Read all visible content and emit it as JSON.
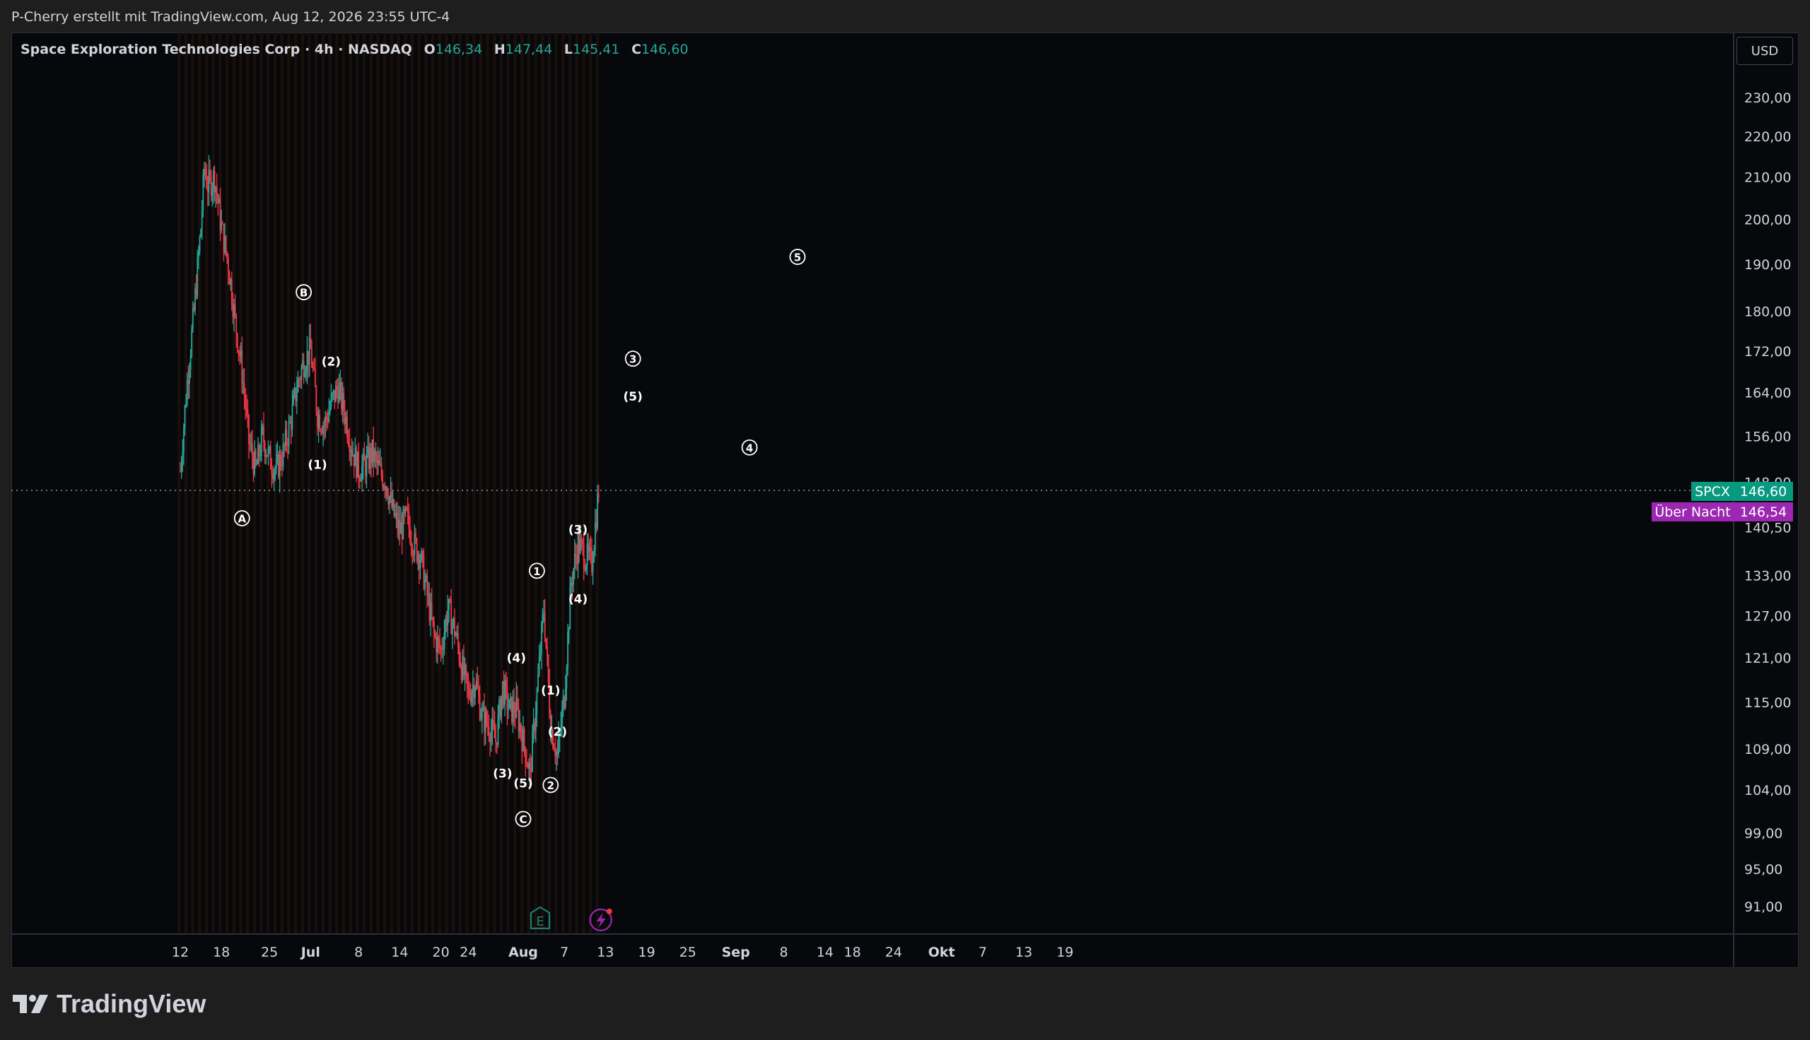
{
  "header": {
    "attribution": "P-Cherry erstellt mit TradingView.com, Aug 12, 2026 23:55 UTC-4"
  },
  "legend": {
    "title": "Space Exploration Technologies Corp · 4h · NASDAQ",
    "open_label": "O",
    "open": "146,34",
    "high_label": "H",
    "high": "147,44",
    "low_label": "L",
    "low": "145,41",
    "close_label": "C",
    "close": "146,60"
  },
  "currency_button": "USD",
  "brand": {
    "name": "TradingView",
    "icon": "tradingview-logo-icon"
  },
  "price_badges": [
    {
      "symbol": "SPCX",
      "value": "146,60",
      "color": "#089981"
    },
    {
      "symbol": "Über Nacht",
      "value": "146,54",
      "color": "#9c27b0"
    }
  ],
  "markers": [
    {
      "icon": "earnings-e-icon",
      "color": "#1e7f6e"
    },
    {
      "icon": "lightning-event-icon",
      "color": "#9c27b0"
    }
  ],
  "colors": {
    "up": "#26a69a",
    "down": "#f23645",
    "background": "#07080c",
    "session_stripe": "#2a1608"
  },
  "chart_data": {
    "type": "candlestick",
    "title": "Space Exploration Technologies Corp · 4h · NASDAQ",
    "y_scale": "log",
    "ylim": [
      88,
      242
    ],
    "y_ticks": [
      {
        "v": 230,
        "label": "230,00"
      },
      {
        "v": 220,
        "label": "220,00"
      },
      {
        "v": 210,
        "label": "210,00"
      },
      {
        "v": 200,
        "label": "200,00"
      },
      {
        "v": 190,
        "label": "190,00"
      },
      {
        "v": 180,
        "label": "180,00"
      },
      {
        "v": 172,
        "label": "172,00"
      },
      {
        "v": 164,
        "label": "164,00"
      },
      {
        "v": 156,
        "label": "156,00"
      },
      {
        "v": 148,
        "label": "148,00"
      },
      {
        "v": 140.5,
        "label": "140,50"
      },
      {
        "v": 133,
        "label": "133,00"
      },
      {
        "v": 127,
        "label": "127,00"
      },
      {
        "v": 121,
        "label": "121,00"
      },
      {
        "v": 115,
        "label": "115,00"
      },
      {
        "v": 109,
        "label": "109,00"
      },
      {
        "v": 104,
        "label": "104,00"
      },
      {
        "v": 99,
        "label": "99,00"
      },
      {
        "v": 95,
        "label": "95,00"
      },
      {
        "v": 91,
        "label": "91,00"
      }
    ],
    "x_start": "2026-06-12",
    "x_ticks": [
      {
        "date": "2026-06-12",
        "label": "12"
      },
      {
        "date": "2026-06-18",
        "label": "18"
      },
      {
        "date": "2026-06-25",
        "label": "25"
      },
      {
        "date": "2026-07-01",
        "label": "Jul",
        "bold": true
      },
      {
        "date": "2026-07-08",
        "label": "8"
      },
      {
        "date": "2026-07-14",
        "label": "14"
      },
      {
        "date": "2026-07-20",
        "label": "20"
      },
      {
        "date": "2026-07-24",
        "label": "24"
      },
      {
        "date": "2026-08-01",
        "label": "Aug",
        "bold": true
      },
      {
        "date": "2026-08-07",
        "label": "7"
      },
      {
        "date": "2026-08-13",
        "label": "13"
      },
      {
        "date": "2026-08-19",
        "label": "19"
      },
      {
        "date": "2026-08-25",
        "label": "25"
      },
      {
        "date": "2026-09-01",
        "label": "Sep",
        "bold": true
      },
      {
        "date": "2026-09-08",
        "label": "8"
      },
      {
        "date": "2026-09-14",
        "label": "14"
      },
      {
        "date": "2026-09-18",
        "label": "18"
      },
      {
        "date": "2026-09-24",
        "label": "24"
      },
      {
        "date": "2026-10-01",
        "label": "Okt",
        "bold": true
      },
      {
        "date": "2026-10-07",
        "label": "7"
      },
      {
        "date": "2026-10-13",
        "label": "13"
      },
      {
        "date": "2026-10-19",
        "label": "19"
      }
    ],
    "last_price": 146.6,
    "price_path": [
      [
        "2026-06-12",
        150
      ],
      [
        "2026-06-13",
        166
      ],
      [
        "2026-06-14",
        180
      ],
      [
        "2026-06-15",
        198
      ],
      [
        "2026-06-15.5",
        212
      ],
      [
        "2026-06-16",
        208
      ],
      [
        "2026-06-17",
        210
      ],
      [
        "2026-06-18",
        198
      ],
      [
        "2026-06-19",
        190
      ],
      [
        "2026-06-20",
        178
      ],
      [
        "2026-06-21",
        168
      ],
      [
        "2026-06-22",
        155
      ],
      [
        "2026-06-23",
        150
      ],
      [
        "2026-06-24",
        156
      ],
      [
        "2026-06-25",
        152
      ],
      [
        "2026-06-26",
        150
      ],
      [
        "2026-06-27",
        153
      ],
      [
        "2026-06-28",
        158
      ],
      [
        "2026-06-29",
        165
      ],
      [
        "2026-06-30",
        170
      ],
      [
        "2026-07-01",
        172
      ],
      [
        "2026-07-02",
        160
      ],
      [
        "2026-07-03",
        158
      ],
      [
        "2026-07-04",
        162
      ],
      [
        "2026-07-05",
        165
      ],
      [
        "2026-07-06",
        160
      ],
      [
        "2026-07-07",
        154
      ],
      [
        "2026-07-08",
        150
      ],
      [
        "2026-07-09",
        151
      ],
      [
        "2026-07-10",
        153
      ],
      [
        "2026-07-11",
        150
      ],
      [
        "2026-07-12",
        148
      ],
      [
        "2026-07-13",
        143
      ],
      [
        "2026-07-14",
        140
      ],
      [
        "2026-07-15",
        142
      ],
      [
        "2026-07-16",
        138
      ],
      [
        "2026-07-17",
        136
      ],
      [
        "2026-07-18",
        130
      ],
      [
        "2026-07-19",
        124
      ],
      [
        "2026-07-20",
        122
      ],
      [
        "2026-07-21",
        128
      ],
      [
        "2026-07-22",
        125
      ],
      [
        "2026-07-23",
        120
      ],
      [
        "2026-07-24",
        116
      ],
      [
        "2026-07-25",
        118
      ],
      [
        "2026-07-26",
        113
      ],
      [
        "2026-07-27",
        112
      ],
      [
        "2026-07-28",
        110
      ],
      [
        "2026-07-29",
        117
      ],
      [
        "2026-07-30",
        114
      ],
      [
        "2026-07-31",
        114
      ],
      [
        "2026-08-01",
        110
      ],
      [
        "2026-08-02",
        106
      ],
      [
        "2026-08-03",
        116
      ],
      [
        "2026-08-04",
        128
      ],
      [
        "2026-08-05",
        112
      ],
      [
        "2026-08-06",
        108
      ],
      [
        "2026-08-07",
        116
      ],
      [
        "2026-08-08",
        132
      ],
      [
        "2026-08-09",
        138
      ],
      [
        "2026-08-10",
        136
      ],
      [
        "2026-08-11",
        135
      ],
      [
        "2026-08-12",
        146.6
      ]
    ],
    "wave_labels": [
      {
        "date": "2026-06-21",
        "price": 142,
        "text": "A",
        "circled": true
      },
      {
        "date": "2026-06-30",
        "price": 184,
        "text": "B",
        "circled": true
      },
      {
        "date": "2026-07-02",
        "price": 151,
        "text": "(1)",
        "circled": false
      },
      {
        "date": "2026-07-04",
        "price": 170,
        "text": "(2)",
        "circled": false
      },
      {
        "date": "2026-07-29",
        "price": 106,
        "text": "(3)",
        "circled": false
      },
      {
        "date": "2026-07-31",
        "price": 121,
        "text": "(4)",
        "circled": false
      },
      {
        "date": "2026-08-01",
        "price": 104.8,
        "text": "(5)",
        "circled": false
      },
      {
        "date": "2026-08-01",
        "price": 100.6,
        "text": "C",
        "circled": true
      },
      {
        "date": "2026-08-03",
        "price": 133.7,
        "text": "1",
        "circled": true
      },
      {
        "date": "2026-08-05",
        "price": 116.6,
        "text": "(1)",
        "circled": false
      },
      {
        "date": "2026-08-06",
        "price": 111.2,
        "text": "(2)",
        "circled": false
      },
      {
        "date": "2026-08-05",
        "price": 104.6,
        "text": "2",
        "circled": true
      },
      {
        "date": "2026-08-09",
        "price": 140.2,
        "text": "(3)",
        "circled": false
      },
      {
        "date": "2026-08-09",
        "price": 129.5,
        "text": "(4)",
        "circled": false
      },
      {
        "date": "2026-08-17",
        "price": 170.5,
        "text": "3",
        "circled": true
      },
      {
        "date": "2026-08-17",
        "price": 163.3,
        "text": "(5)",
        "circled": false
      },
      {
        "date": "2026-09-03",
        "price": 154,
        "text": "4",
        "circled": true
      },
      {
        "date": "2026-09-10",
        "price": 191.6,
        "text": "5",
        "circled": true
      }
    ]
  }
}
